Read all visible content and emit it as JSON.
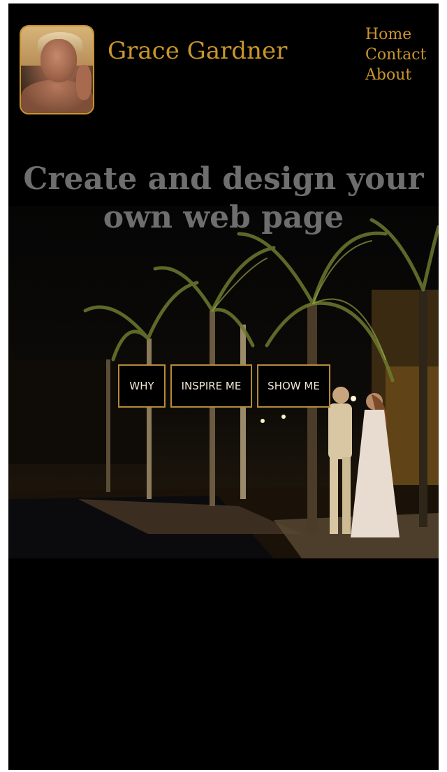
{
  "header": {
    "site_title": "Grace Gardner",
    "avatar_alt": "Grace Gardner portrait"
  },
  "nav": {
    "items": [
      "Home",
      "Contact",
      "About"
    ]
  },
  "hero": {
    "headline": "Create and design your own web page",
    "buttons": [
      "WHY",
      "INSPIRE ME",
      "SHOW ME"
    ]
  },
  "colors": {
    "accent": "#c9952c",
    "background": "#000000",
    "headline": "#6e6e6e",
    "button_border": "#b58a3a",
    "button_text": "#f0e6d4"
  },
  "icons": {
    "avatar": "portrait-photo"
  }
}
